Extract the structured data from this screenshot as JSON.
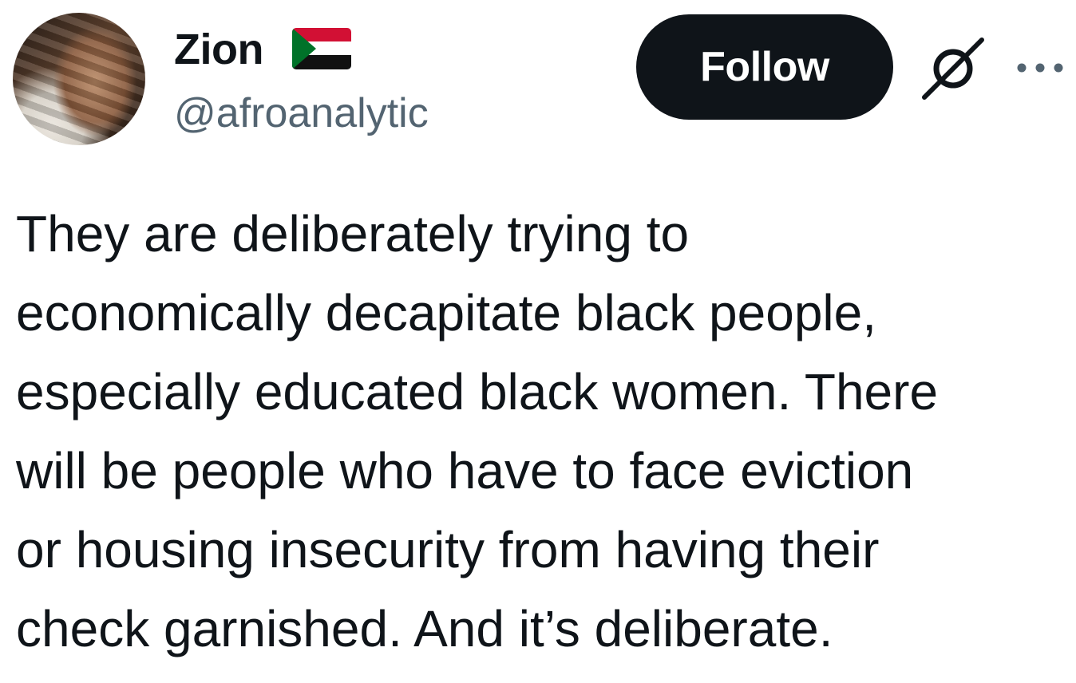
{
  "author": {
    "display_name": "Zion",
    "flag": "flag-sudan-icon",
    "handle": "@afroanalytic",
    "avatar": "avatar"
  },
  "actions": {
    "follow_label": "Follow",
    "grok_icon": "grok-icon",
    "more_icon": "more-options-icon"
  },
  "tweet": {
    "text": "They are deliberately trying to\neconomically decapitate black people,\nespecially educated black women. There\nwill be people who have to face eviction\nor housing insecurity from having their\ncheck garnished. And it’s deliberate."
  },
  "colors": {
    "text_primary": "#0f1419",
    "text_secondary": "#536471",
    "button_bg": "#0f1419",
    "button_text": "#ffffff"
  }
}
